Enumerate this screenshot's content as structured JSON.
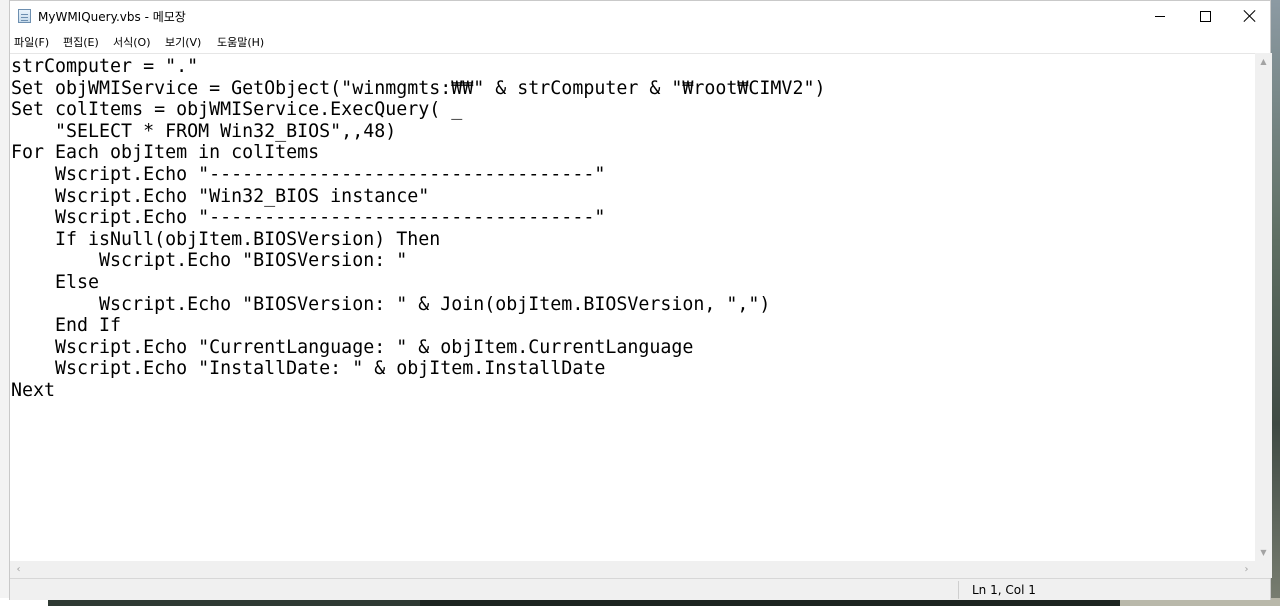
{
  "window": {
    "title": "MyWMIQuery.vbs - 메모장"
  },
  "menu": [
    {
      "label": "파일(F)"
    },
    {
      "label": "편집(E)"
    },
    {
      "label": "서식(O)"
    },
    {
      "label": "보기(V)"
    },
    {
      "label": "도움말(H)"
    }
  ],
  "editor": {
    "lines": [
      "strComputer = \".\"",
      "Set objWMIService = GetObject(\"winmgmts:₩₩\" & strComputer & \"₩root₩CIMV2\")",
      "Set colItems = objWMIService.ExecQuery( _",
      "    \"SELECT * FROM Win32_BIOS\",,48)",
      "For Each objItem in colItems",
      "    Wscript.Echo \"-----------------------------------\"",
      "    Wscript.Echo \"Win32_BIOS instance\"",
      "    Wscript.Echo \"-----------------------------------\"",
      "    If isNull(objItem.BIOSVersion) Then",
      "        Wscript.Echo \"BIOSVersion: \"",
      "    Else",
      "        Wscript.Echo \"BIOSVersion: \" & Join(objItem.BIOSVersion, \",\")",
      "    End If",
      "    Wscript.Echo \"CurrentLanguage: \" & objItem.CurrentLanguage",
      "    Wscript.Echo \"InstallDate: \" & objItem.InstallDate",
      "Next"
    ]
  },
  "status": {
    "position": "Ln 1, Col 1"
  },
  "icons": {
    "app": "notepad-icon",
    "minimize": "minimize-icon",
    "maximize": "maximize-icon",
    "close": "close-icon"
  },
  "colors": {
    "chrome": "#f0f0f0",
    "editor_bg": "#ffffff",
    "text": "#000000"
  }
}
